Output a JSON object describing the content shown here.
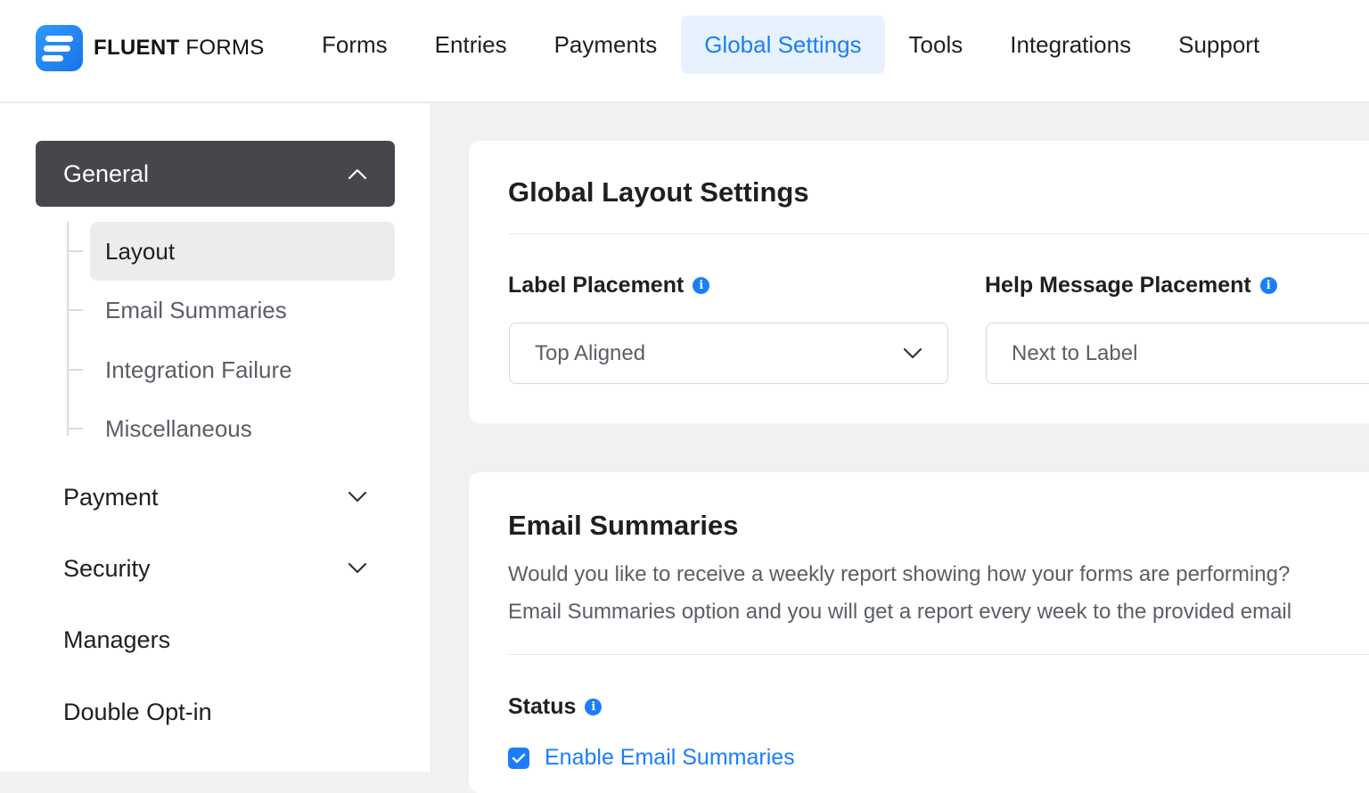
{
  "brand": {
    "name_bold": "FLUENT",
    "name_light": "FORMS"
  },
  "nav": {
    "forms": "Forms",
    "entries": "Entries",
    "payments": "Payments",
    "global_settings": "Global Settings",
    "tools": "Tools",
    "integrations": "Integrations",
    "support": "Support",
    "active": "Global Settings"
  },
  "sidebar": {
    "general": {
      "label": "General",
      "items": [
        "Layout",
        "Email Summaries",
        "Integration Failure",
        "Miscellaneous"
      ],
      "active_item": "Layout"
    },
    "payment": "Payment",
    "security": "Security",
    "managers": "Managers",
    "double_opt_in": "Double Opt-in"
  },
  "layout_card": {
    "title": "Global Layout Settings",
    "label_placement": {
      "label": "Label Placement",
      "value": "Top Aligned"
    },
    "help_message_placement": {
      "label": "Help Message Placement",
      "value": "Next to Label"
    }
  },
  "email_card": {
    "title": "Email Summaries",
    "description_line1": "Would you like to receive a weekly report showing how your forms are performing?",
    "description_line2": "Email Summaries option and you will get a report every week to the provided email",
    "status_label": "Status",
    "checkbox_label": "Enable Email Summaries",
    "checkbox_checked": true
  },
  "colors": {
    "accent": "#1a7efb",
    "sidebar_active_bg": "#46474a",
    "nav_active_bg": "#e8f2ff"
  }
}
